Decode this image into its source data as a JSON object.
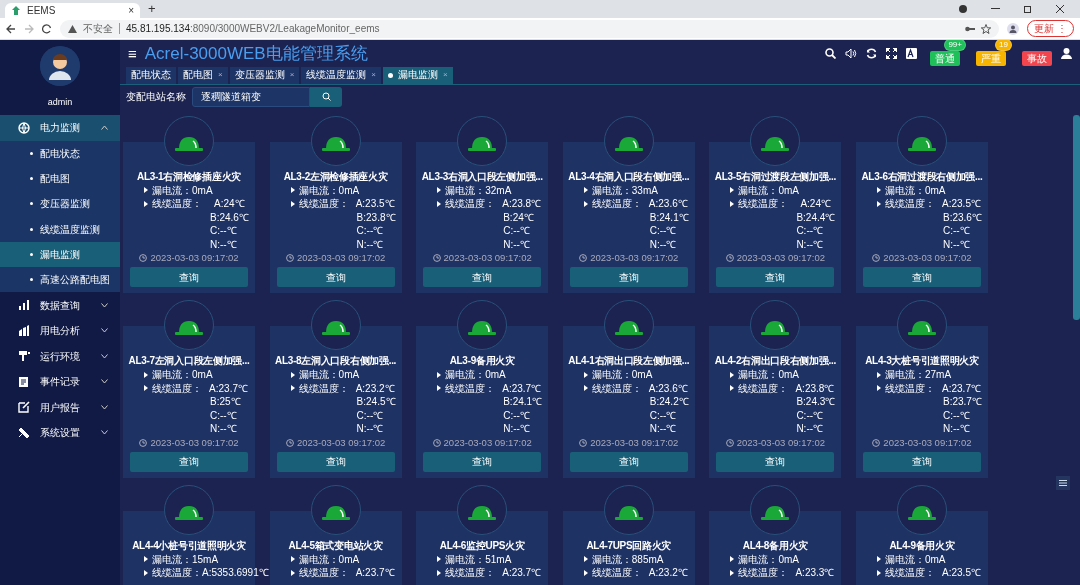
{
  "browser": {
    "tab_title": "EEMS",
    "tab_close": "×",
    "new_tab": "+",
    "security": "不安全",
    "url_host": "45.81.195.134",
    "url_path": ":8090/3000WEBV2/LeakageMonitor_eems",
    "update_button": "更新",
    "update_menu": "⋮"
  },
  "user": {
    "name": "admin"
  },
  "sidebar": {
    "items": [
      {
        "label": "电力监测",
        "kind": "globe",
        "expanded": true,
        "children": [
          {
            "label": "配电状态",
            "selected": false
          },
          {
            "label": "配电图",
            "selected": false
          },
          {
            "label": "变压器监测",
            "selected": false
          },
          {
            "label": "线缆温度监测",
            "selected": false
          },
          {
            "label": "漏电监测",
            "selected": true
          },
          {
            "label": "高速公路配电图",
            "selected": false
          }
        ]
      },
      {
        "label": "数据查询",
        "kind": "bars",
        "expanded": false
      },
      {
        "label": "用电分析",
        "kind": "analysis",
        "expanded": false
      },
      {
        "label": "运行环境",
        "kind": "environment",
        "expanded": false
      },
      {
        "label": "事件记录",
        "kind": "records",
        "expanded": false
      },
      {
        "label": "用户报告",
        "kind": "report",
        "expanded": false
      },
      {
        "label": "系统设置",
        "kind": "tools",
        "expanded": false
      }
    ]
  },
  "header": {
    "menu": "≡",
    "title": "Acrel-3000WEB电能管理系统",
    "alarms": [
      {
        "label": "普通",
        "count": "99+",
        "color": "#1fbf5a"
      },
      {
        "label": "严重",
        "count": "19",
        "color": "#f7b500"
      },
      {
        "label": "事故",
        "color": "#f2454d"
      }
    ]
  },
  "tabs": [
    {
      "label": "配电状态",
      "selected": false
    },
    {
      "label": "配电图",
      "close": "×",
      "selected": false
    },
    {
      "label": "变压器监测",
      "close": "×",
      "selected": false
    },
    {
      "label": "线缆温度监测",
      "close": "×",
      "selected": false
    },
    {
      "label": "漏电监测",
      "close": "×",
      "selected": true
    }
  ],
  "filter": {
    "label": "变配电站名称",
    "value": "逐稠隧道箱变"
  },
  "cards": [
    {
      "name": "AL3-1右洞检修插座火灾",
      "current_label": "漏电流：",
      "current": "0mA",
      "temp_label": "线缆温度：",
      "temps": [
        "A:24℃",
        "B:24.6℃",
        "C:--℃",
        "N:--℃"
      ],
      "time": "2023-03-03 09:17:02",
      "button": "查询"
    },
    {
      "name": "AL3-2左洞检修插座火灾",
      "current_label": "漏电流：",
      "current": "0mA",
      "temp_label": "线缆温度：",
      "temps": [
        "A:23.5℃",
        "B:23.8℃",
        "C:--℃",
        "N:--℃"
      ],
      "time": "2023-03-03 09:17:02",
      "button": "查询"
    },
    {
      "name": "AL3-3右洞入口段左侧加强...",
      "current_label": "漏电流：",
      "current": "32mA",
      "temp_label": "线缆温度：",
      "temps": [
        "A:23.8℃",
        "B:24℃",
        "C:--℃",
        "N:--℃"
      ],
      "time": "2023-03-03 09:17:02",
      "button": "查询"
    },
    {
      "name": "AL3-4右洞入口段右侧加强...",
      "current_label": "漏电流：",
      "current": "33mA",
      "temp_label": "线缆温度：",
      "temps": [
        "A:23.6℃",
        "B:24.1℃",
        "C:--℃",
        "N:--℃"
      ],
      "time": "2023-03-03 09:17:02",
      "button": "查询"
    },
    {
      "name": "AL3-5右洞过渡段左侧加强...",
      "current_label": "漏电流：",
      "current": "0mA",
      "temp_label": "线缆温度：",
      "temps": [
        "A:24℃",
        "B:24.4℃",
        "C:--℃",
        "N:--℃"
      ],
      "time": "2023-03-03 09:17:02",
      "button": "查询"
    },
    {
      "name": "AL3-6右洞过渡段右侧加强...",
      "current_label": "漏电流：",
      "current": "0mA",
      "temp_label": "线缆温度：",
      "temps": [
        "A:23.5℃",
        "B:23.6℃",
        "C:--℃",
        "N:--℃"
      ],
      "time": "2023-03-03 09:17:02",
      "button": "查询"
    },
    {
      "name": "AL3-7左洞入口段左侧加强...",
      "current_label": "漏电流：",
      "current": "0mA",
      "temp_label": "线缆温度：",
      "temps": [
        "A:23.7℃",
        "B:25℃",
        "C:--℃",
        "N:--℃"
      ],
      "time": "2023-03-03 09:17:02",
      "button": "查询"
    },
    {
      "name": "AL3-8左洞入口段右侧加强...",
      "current_label": "漏电流：",
      "current": "0mA",
      "temp_label": "线缆温度：",
      "temps": [
        "A:23.2℃",
        "B:24.5℃",
        "C:--℃",
        "N:--℃"
      ],
      "time": "2023-03-03 09:17:02",
      "button": "查询"
    },
    {
      "name": "AL3-9备用火灾",
      "current_label": "漏电流：",
      "current": "0mA",
      "temp_label": "线缆温度：",
      "temps": [
        "A:23.7℃",
        "B:24.1℃",
        "C:--℃",
        "N:--℃"
      ],
      "time": "2023-03-03 09:17:02",
      "button": "查询"
    },
    {
      "name": "AL4-1右洞出口段左侧加强...",
      "current_label": "漏电流：",
      "current": "0mA",
      "temp_label": "线缆温度：",
      "temps": [
        "A:23.6℃",
        "B:24.2℃",
        "C:--℃",
        "N:--℃"
      ],
      "time": "2023-03-03 09:17:02",
      "button": "查询"
    },
    {
      "name": "AL4-2右洞出口段右侧加强...",
      "current_label": "漏电流：",
      "current": "0mA",
      "temp_label": "线缆温度：",
      "temps": [
        "A:23.8℃",
        "B:24.3℃",
        "C:--℃",
        "N:--℃"
      ],
      "time": "2023-03-03 09:17:02",
      "button": "查询"
    },
    {
      "name": "AL4-3大桩号引道照明火灾",
      "current_label": "漏电流：",
      "current": "27mA",
      "temp_label": "线缆温度：",
      "temps": [
        "A:23.7℃",
        "B:23.7℃",
        "C:--℃",
        "N:--℃"
      ],
      "time": "2023-03-03 09:17:02",
      "button": "查询"
    },
    {
      "name": "AL4-4小桩号引道照明火灾",
      "current_label": "漏电流：",
      "current": "15mA",
      "temp_label": "线缆温度：",
      "temps": [
        "A:5353.6991℃"
      ]
    },
    {
      "name": "AL4-5箱式变电站火灾",
      "current_label": "漏电流：",
      "current": "0mA",
      "temp_label": "线缆温度：",
      "temps": [
        "A:23.7℃"
      ]
    },
    {
      "name": "AL4-6监控UPS火灾",
      "current_label": "漏电流：",
      "current": "51mA",
      "temp_label": "线缆温度：",
      "temps": [
        "A:23.7℃"
      ]
    },
    {
      "name": "AL4-7UPS回路火灾",
      "current_label": "漏电流：",
      "current": "885mA",
      "temp_label": "线缆温度：",
      "temps": [
        "A:23.2℃"
      ]
    },
    {
      "name": "AL4-8备用火灾",
      "current_label": "漏电流：",
      "current": "0mA",
      "temp_label": "线缆温度：",
      "temps": [
        "A:23.3℃"
      ]
    },
    {
      "name": "AL4-9备用火灾",
      "current_label": "漏电流：",
      "current": "0mA",
      "temp_label": "线缆温度：",
      "temps": [
        "A:23.5℃"
      ]
    }
  ]
}
